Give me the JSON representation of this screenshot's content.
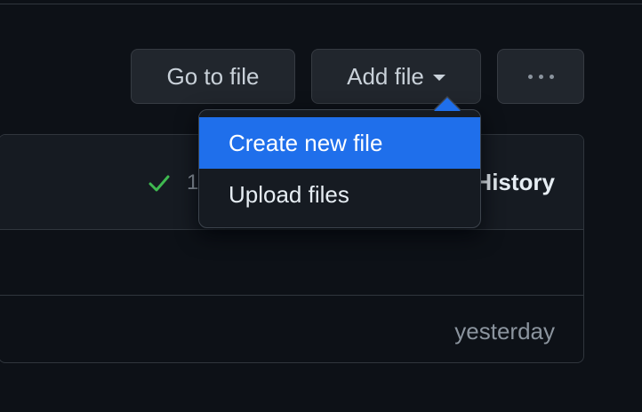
{
  "toolbar": {
    "go_to_file_label": "Go to file",
    "add_file_label": "Add file",
    "more_icon": "kebab-horizontal-icon"
  },
  "add_file_menu": {
    "items": [
      {
        "label": "Create new file",
        "active": true
      },
      {
        "label": "Upload files",
        "active": false
      }
    ]
  },
  "file_box": {
    "header": {
      "status_icon": "check-icon",
      "commit_count_partial": "1",
      "history_label": "History"
    },
    "rows": [
      {
        "time": ""
      },
      {
        "time": "yesterday"
      }
    ]
  },
  "colors": {
    "background": "#0d1117",
    "button_bg": "#21262d",
    "menu_active": "#1f6feb",
    "success": "#3fb950",
    "muted_text": "#8b949e"
  }
}
